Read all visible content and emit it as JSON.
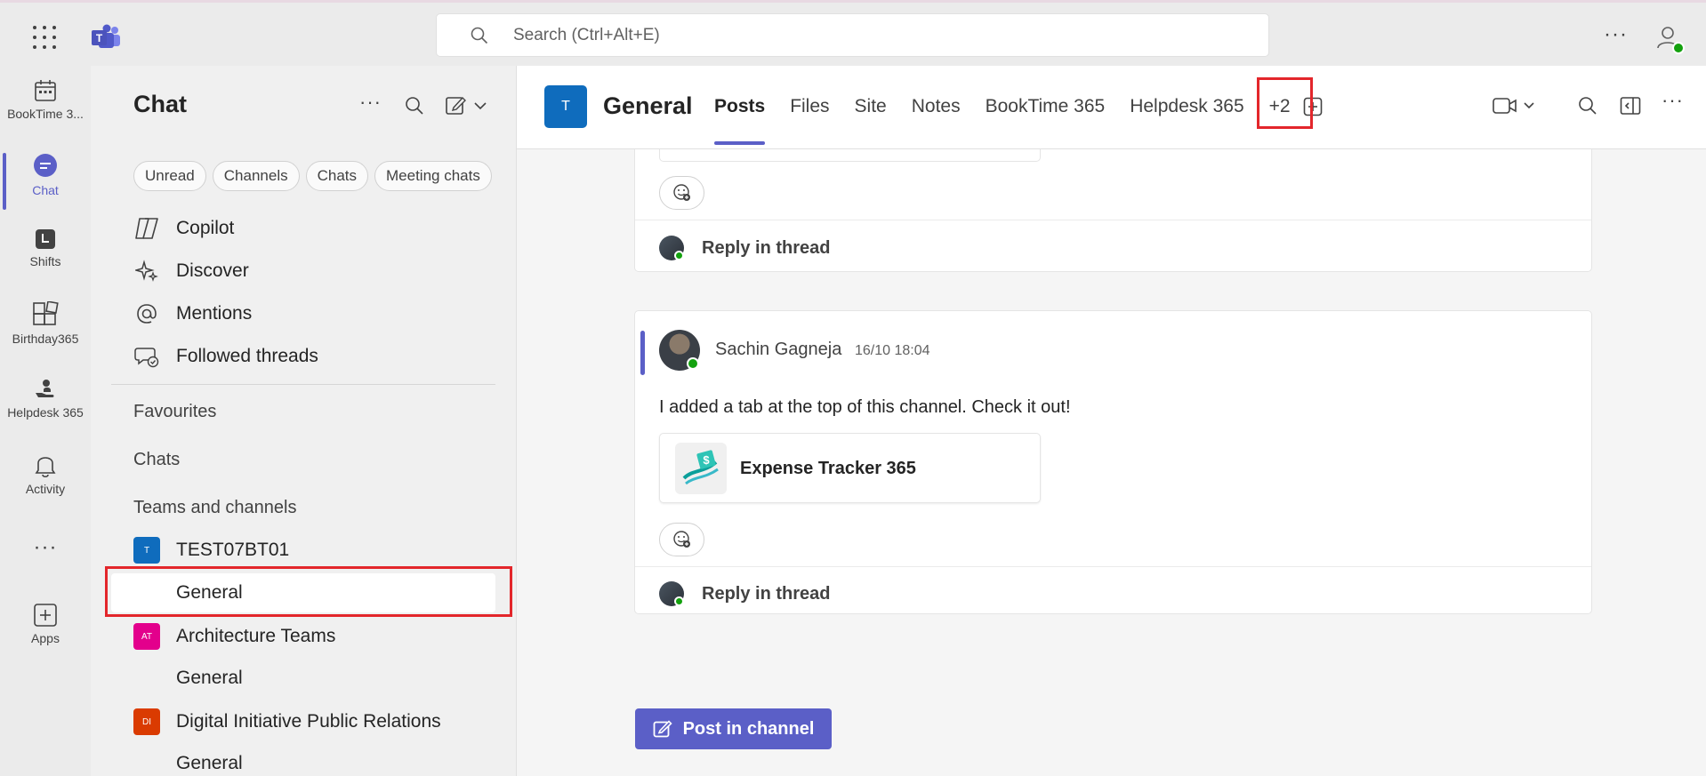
{
  "search": {
    "placeholder": "Search (Ctrl+Alt+E)"
  },
  "rail": {
    "items": [
      {
        "label": "BookTime 3..."
      },
      {
        "label": "Chat"
      },
      {
        "label": "Shifts"
      },
      {
        "label": "Birthday365"
      },
      {
        "label": "Helpdesk 365"
      },
      {
        "label": "Activity"
      },
      {
        "label": ""
      },
      {
        "label": "Apps"
      }
    ]
  },
  "left_pane": {
    "title": "Chat",
    "filters": [
      "Unread",
      "Channels",
      "Chats",
      "Meeting chats"
    ],
    "nav": [
      "Copilot",
      "Discover",
      "Mentions",
      "Followed threads"
    ],
    "sections": [
      "Favourites",
      "Chats",
      "Teams and channels"
    ],
    "teams": [
      {
        "initials": "T",
        "name": "TEST07BT01",
        "color": "#0f6cbd",
        "channel": "General"
      },
      {
        "initials": "AT",
        "name": "Architecture Teams",
        "color": "#e3008c",
        "channel": "General"
      },
      {
        "initials": "DI",
        "name": "Digital Initiative Public Relations",
        "color": "#da3b01",
        "channel": "General"
      }
    ]
  },
  "channel": {
    "avatar": "T",
    "title": "General",
    "tabs": [
      "Posts",
      "Files",
      "Site",
      "Notes",
      "BookTime 365",
      "Helpdesk 365",
      "+2"
    ]
  },
  "thread": {
    "reply_label": "Reply in thread",
    "message": {
      "author": "Sachin Gagneja",
      "time": "16/10 18:04",
      "text": "I added a tab at the top of this channel. Check it out!",
      "card_title": "Expense Tracker 365"
    }
  },
  "post_button": "Post in channel",
  "colors": {
    "accent": "#5b5fc7",
    "highlight": "#e3262b",
    "presence": "#13a10e"
  }
}
